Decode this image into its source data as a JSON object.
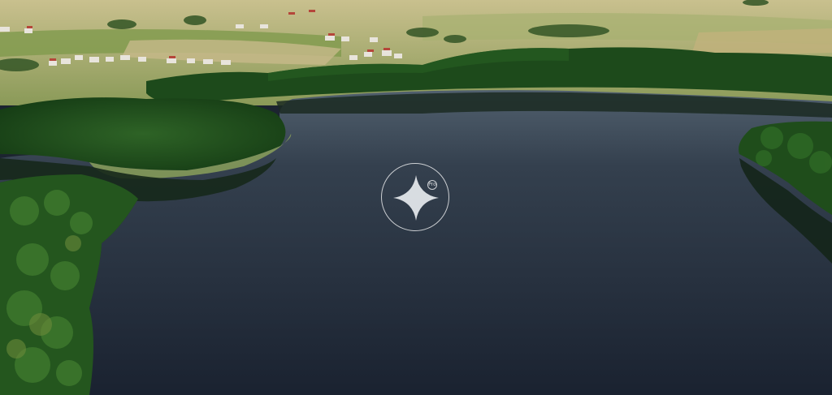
{
  "scene": {
    "subject": "aerial-lake-forest-landscape",
    "colors": {
      "water": "#1f2a38",
      "forest": "#1f4a1c",
      "field": "#9aa36a",
      "sky_haze": "#b8b48a"
    }
  },
  "overlay": {
    "play_icon": "sparkle-play-icon",
    "badge_text": "Pro"
  }
}
